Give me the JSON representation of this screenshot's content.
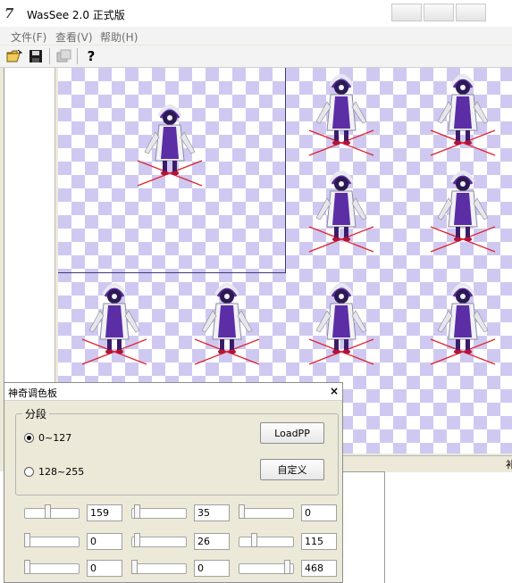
{
  "window": {
    "logo": "7",
    "title": "WasSee 2.0 正式版"
  },
  "menu": [
    {
      "id": "file",
      "label": "文件(F)"
    },
    {
      "id": "view",
      "label": "查看(V)"
    },
    {
      "id": "help",
      "label": "帮助(H)"
    }
  ],
  "toolbar": {
    "buttons": [
      {
        "icon": "open-folder-icon"
      },
      {
        "icon": "save-icon"
      },
      {
        "icon": "properties-icon",
        "disabled": true
      },
      {
        "icon": "help-icon",
        "glyph": "?"
      }
    ]
  },
  "colors": {
    "checker": "#cfc9f2",
    "sprite_primary": "#5b2ea6",
    "floor_cross": "#e0242c"
  },
  "status": {
    "grip": "补"
  },
  "palette": {
    "title": "神奇调色板",
    "close": "×",
    "group_label": "分段",
    "range_options": [
      {
        "label": "0~127",
        "selected": true
      },
      {
        "label": "128~255",
        "selected": false
      }
    ],
    "loadpp_label": "LoadPP",
    "custom_label": "自定义",
    "rows": [
      [
        {
          "value": "159",
          "level": 0.42
        },
        {
          "value": "35",
          "level": 0.05
        },
        {
          "value": "0",
          "level": 0.0
        }
      ],
      [
        {
          "value": "0",
          "level": 0.0
        },
        {
          "value": "26",
          "level": 0.05
        },
        {
          "value": "115",
          "level": 0.25
        }
      ],
      [
        {
          "value": "0",
          "level": 0.0
        },
        {
          "value": "0",
          "level": 0.0
        },
        {
          "value": "468",
          "level": 0.95
        }
      ]
    ]
  }
}
